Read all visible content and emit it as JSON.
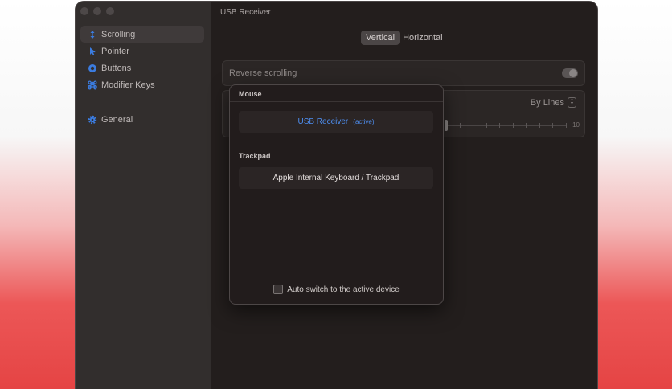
{
  "window": {
    "title": "USB Receiver"
  },
  "sidebar": {
    "items": [
      {
        "label": "Scrolling",
        "icon": "scroll-arrows-icon",
        "active": true
      },
      {
        "label": "Pointer",
        "icon": "cursor-arrow-icon",
        "active": false
      },
      {
        "label": "Buttons",
        "icon": "buttons-icon",
        "active": false
      },
      {
        "label": "Modifier Keys",
        "icon": "command-icon",
        "active": false
      },
      {
        "label": "General",
        "icon": "gear-icon",
        "active": false
      }
    ]
  },
  "orientation": {
    "tabs": [
      "Vertical",
      "Horizontal"
    ],
    "selected": "Vertical"
  },
  "settings": {
    "reverse_scrolling_label": "Reverse scrolling",
    "reverse_scrolling_on": true,
    "mode_value": "By Lines",
    "speed_max_label": "10"
  },
  "device_picker": {
    "mouse_header": "Mouse",
    "mouse_device": "USB Receiver",
    "mouse_device_tag": "(active)",
    "trackpad_header": "Trackpad",
    "trackpad_device": "Apple Internal Keyboard / Trackpad",
    "auto_switch_label": "Auto switch to the active device",
    "auto_switch_checked": false
  },
  "colors": {
    "accent": "#4e8ef0",
    "window_bg": "#231e1d",
    "sidebar_bg": "#322e2d"
  }
}
